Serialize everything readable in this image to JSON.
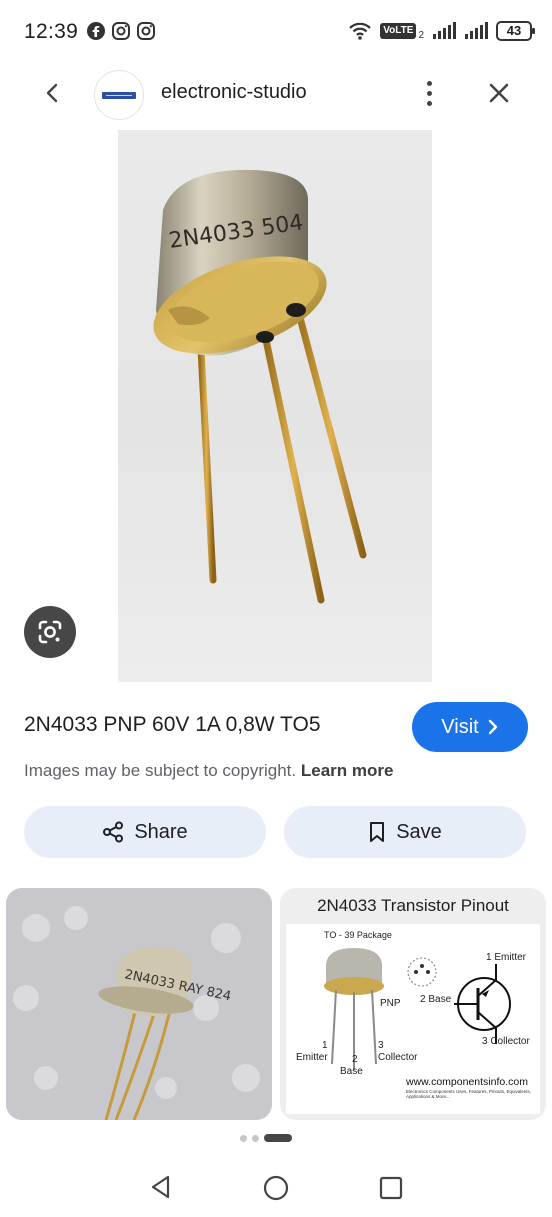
{
  "status_bar": {
    "time": "12:39",
    "network_label": "VoLTE",
    "network_sub": "2",
    "battery": "43",
    "icons": [
      "facebook-icon",
      "instagram-icon",
      "instagram-icon",
      "wifi-icon",
      "signal-icon",
      "signal-icon"
    ]
  },
  "header": {
    "site_name": "electronic-studio",
    "icons": [
      "back-arrow-icon",
      "more-vert-icon",
      "close-icon"
    ]
  },
  "main_image": {
    "marking": "2N4033 504",
    "icon": "google-lens-icon"
  },
  "result": {
    "title": "2N4033 PNP 60V 1A 0,8W TO5",
    "visit_label": "Visit",
    "copyright_text": "Images may be subject to copyright.",
    "learn_more_label": "Learn more"
  },
  "actions": {
    "share_label": "Share",
    "save_label": "Save"
  },
  "related": [
    {
      "marking": "2N4033 RAY 824"
    },
    {
      "title": "2N4033 Transistor Pinout",
      "package_label": "TO - 39 Package",
      "pnp_label": "PNP",
      "pins": {
        "emitter": "1 Emitter",
        "base": "2 Base",
        "collector": "3 Collector"
      },
      "lead_labels": {
        "emitter_num": "1",
        "emitter": "Emitter",
        "base_num": "2",
        "base": "Base",
        "collector_num": "3",
        "collector": "Collector"
      },
      "url": "www.componentsinfo.com",
      "tagline": "Electronics Components Uses, Features, Pinouts, Equivalents, Applications & More..."
    }
  ],
  "pager": {
    "current": 3,
    "total": 3
  },
  "nav": {
    "icons": [
      "back-triangle-icon",
      "home-circle-icon",
      "recents-square-icon"
    ]
  }
}
